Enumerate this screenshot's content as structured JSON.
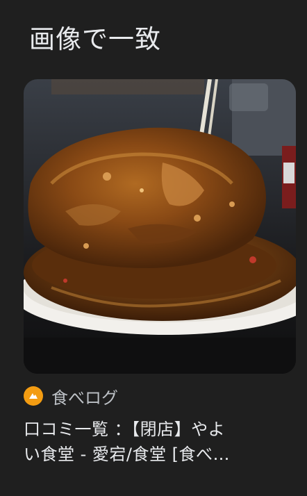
{
  "section": {
    "title": "画像で一致"
  },
  "result": {
    "image_icon": "food-photo",
    "source": {
      "icon": "tabelog-icon",
      "icon_color": "#f39c12",
      "name": "食べログ"
    },
    "title_line1": "口コミ一覧 ：【閉店】やよ",
    "title_line2": "い食堂 - 愛宕/食堂 [食べ…"
  }
}
